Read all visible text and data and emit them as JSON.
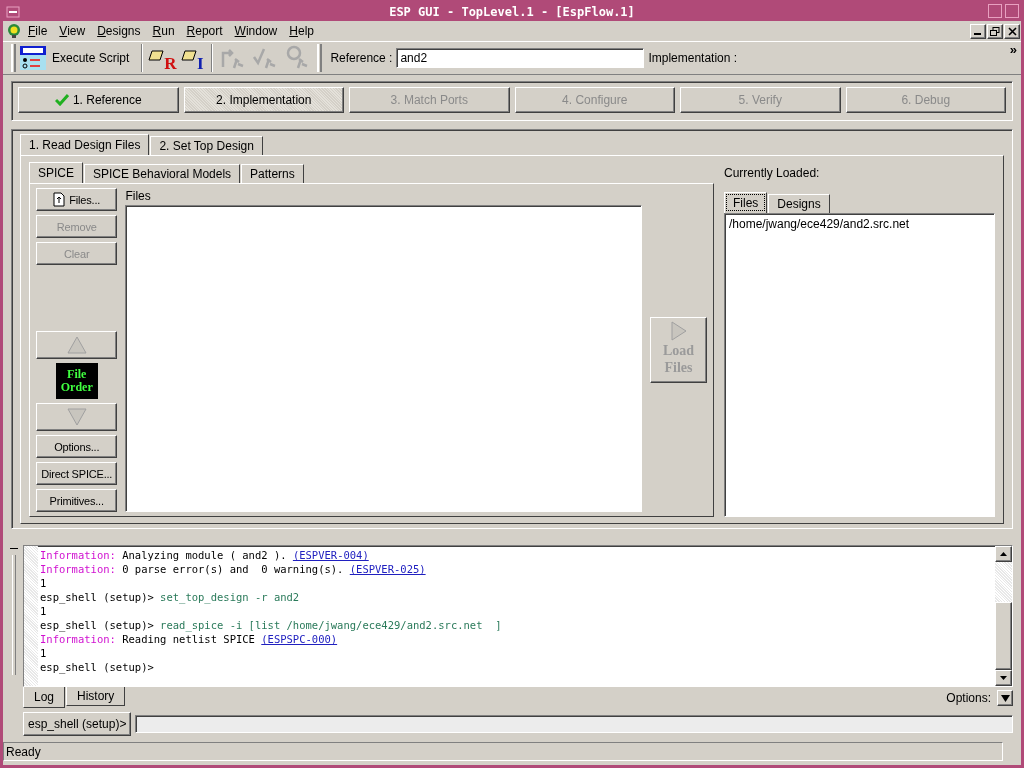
{
  "window": {
    "title": "ESP GUI - TopLevel.1 - [EspFlow.1]"
  },
  "menu": [
    {
      "label": "File"
    },
    {
      "label": "View"
    },
    {
      "label": "Designs"
    },
    {
      "label": "Run"
    },
    {
      "label": "Report"
    },
    {
      "label": "Window"
    },
    {
      "label": "Help"
    }
  ],
  "toolbar": {
    "execute_label": "Execute Script",
    "eraser_tools": [
      {
        "letter": "R",
        "color": "#d01010"
      },
      {
        "letter": "I",
        "color": "#1020b0"
      }
    ],
    "flow_tools": [
      {
        "disabled": true
      },
      {
        "disabled": true
      },
      {
        "disabled": true
      }
    ],
    "reference_label": "Reference :",
    "reference_value": "and2",
    "implementation_label": "Implementation :",
    "overflow": "»"
  },
  "flow_steps": [
    {
      "label": "1. Reference",
      "done": true,
      "selected": false,
      "disabled": false
    },
    {
      "label": "2. Implementation",
      "done": false,
      "selected": true,
      "disabled": false
    },
    {
      "label": "3. Match Ports",
      "done": false,
      "selected": false,
      "disabled": true
    },
    {
      "label": "4. Configure",
      "done": false,
      "selected": false,
      "disabled": true
    },
    {
      "label": "5. Verify",
      "done": false,
      "selected": false,
      "disabled": true
    },
    {
      "label": "6. Debug",
      "done": false,
      "selected": false,
      "disabled": true
    }
  ],
  "phase_tabs": [
    {
      "label": "1. Read Design Files",
      "selected": true
    },
    {
      "label": "2. Set Top Design",
      "selected": false
    }
  ],
  "source_tabs": [
    {
      "label": "SPICE",
      "selected": true
    },
    {
      "label": "SPICE Behavioral Models",
      "selected": false
    },
    {
      "label": "Patterns",
      "selected": false
    }
  ],
  "file_actions": [
    {
      "label": "Files...",
      "disabled": false
    },
    {
      "label": "Remove",
      "disabled": true
    },
    {
      "label": "Clear",
      "disabled": true
    }
  ],
  "order": {
    "up_disabled": true,
    "down_disabled": true,
    "badge": [
      "File",
      "Order"
    ]
  },
  "more_actions": [
    {
      "label": "Options..."
    },
    {
      "label": "Direct SPICE..."
    },
    {
      "label": "Primitives..."
    }
  ],
  "files_list": {
    "header": "Files"
  },
  "load_button": {
    "lines": [
      "Load",
      "Files"
    ],
    "disabled": true
  },
  "loaded": {
    "title": "Currently Loaded:",
    "tabs": [
      {
        "label": "Files",
        "selected": true
      },
      {
        "label": "Designs",
        "selected": false
      }
    ],
    "items": [
      "/home/jwang/ece429/and2.src.net"
    ]
  },
  "log": {
    "lines": [
      [
        {
          "kind": "info",
          "text": "Information:"
        },
        {
          "kind": "text",
          "text": " Analyzing module ( and2 ). "
        },
        {
          "kind": "link",
          "text": "(ESPVER-004)"
        }
      ],
      [
        {
          "kind": "info",
          "text": "Information:"
        },
        {
          "kind": "text",
          "text": " 0 parse error(s) and  0 warning(s). "
        },
        {
          "kind": "link",
          "text": "(ESPVER-025)"
        }
      ],
      [
        {
          "kind": "text",
          "text": "1"
        }
      ],
      [
        {
          "kind": "text",
          "text": "esp_shell (setup)> "
        },
        {
          "kind": "cmd",
          "text": "set_top_design -r and2"
        }
      ],
      [
        {
          "kind": "text",
          "text": "1"
        }
      ],
      [
        {
          "kind": "text",
          "text": "esp_shell (setup)> "
        },
        {
          "kind": "cmd",
          "text": "read_spice -i [list /home/jwang/ece429/and2.src.net  ]"
        }
      ],
      [
        {
          "kind": "info",
          "text": "Information:"
        },
        {
          "kind": "text",
          "text": " Reading netlist SPICE "
        },
        {
          "kind": "link",
          "text": "(ESPSPC-000)"
        }
      ],
      [
        {
          "kind": "text",
          "text": "1"
        }
      ],
      [
        {
          "kind": "text",
          "text": "esp_shell (setup)>"
        }
      ]
    ],
    "tabs": [
      {
        "label": "Log",
        "selected": true
      },
      {
        "label": "History",
        "selected": false
      }
    ],
    "options_label": "Options:"
  },
  "prompt": {
    "label": "esp_shell (setup)>"
  },
  "status_bar": {
    "text": "Ready"
  }
}
